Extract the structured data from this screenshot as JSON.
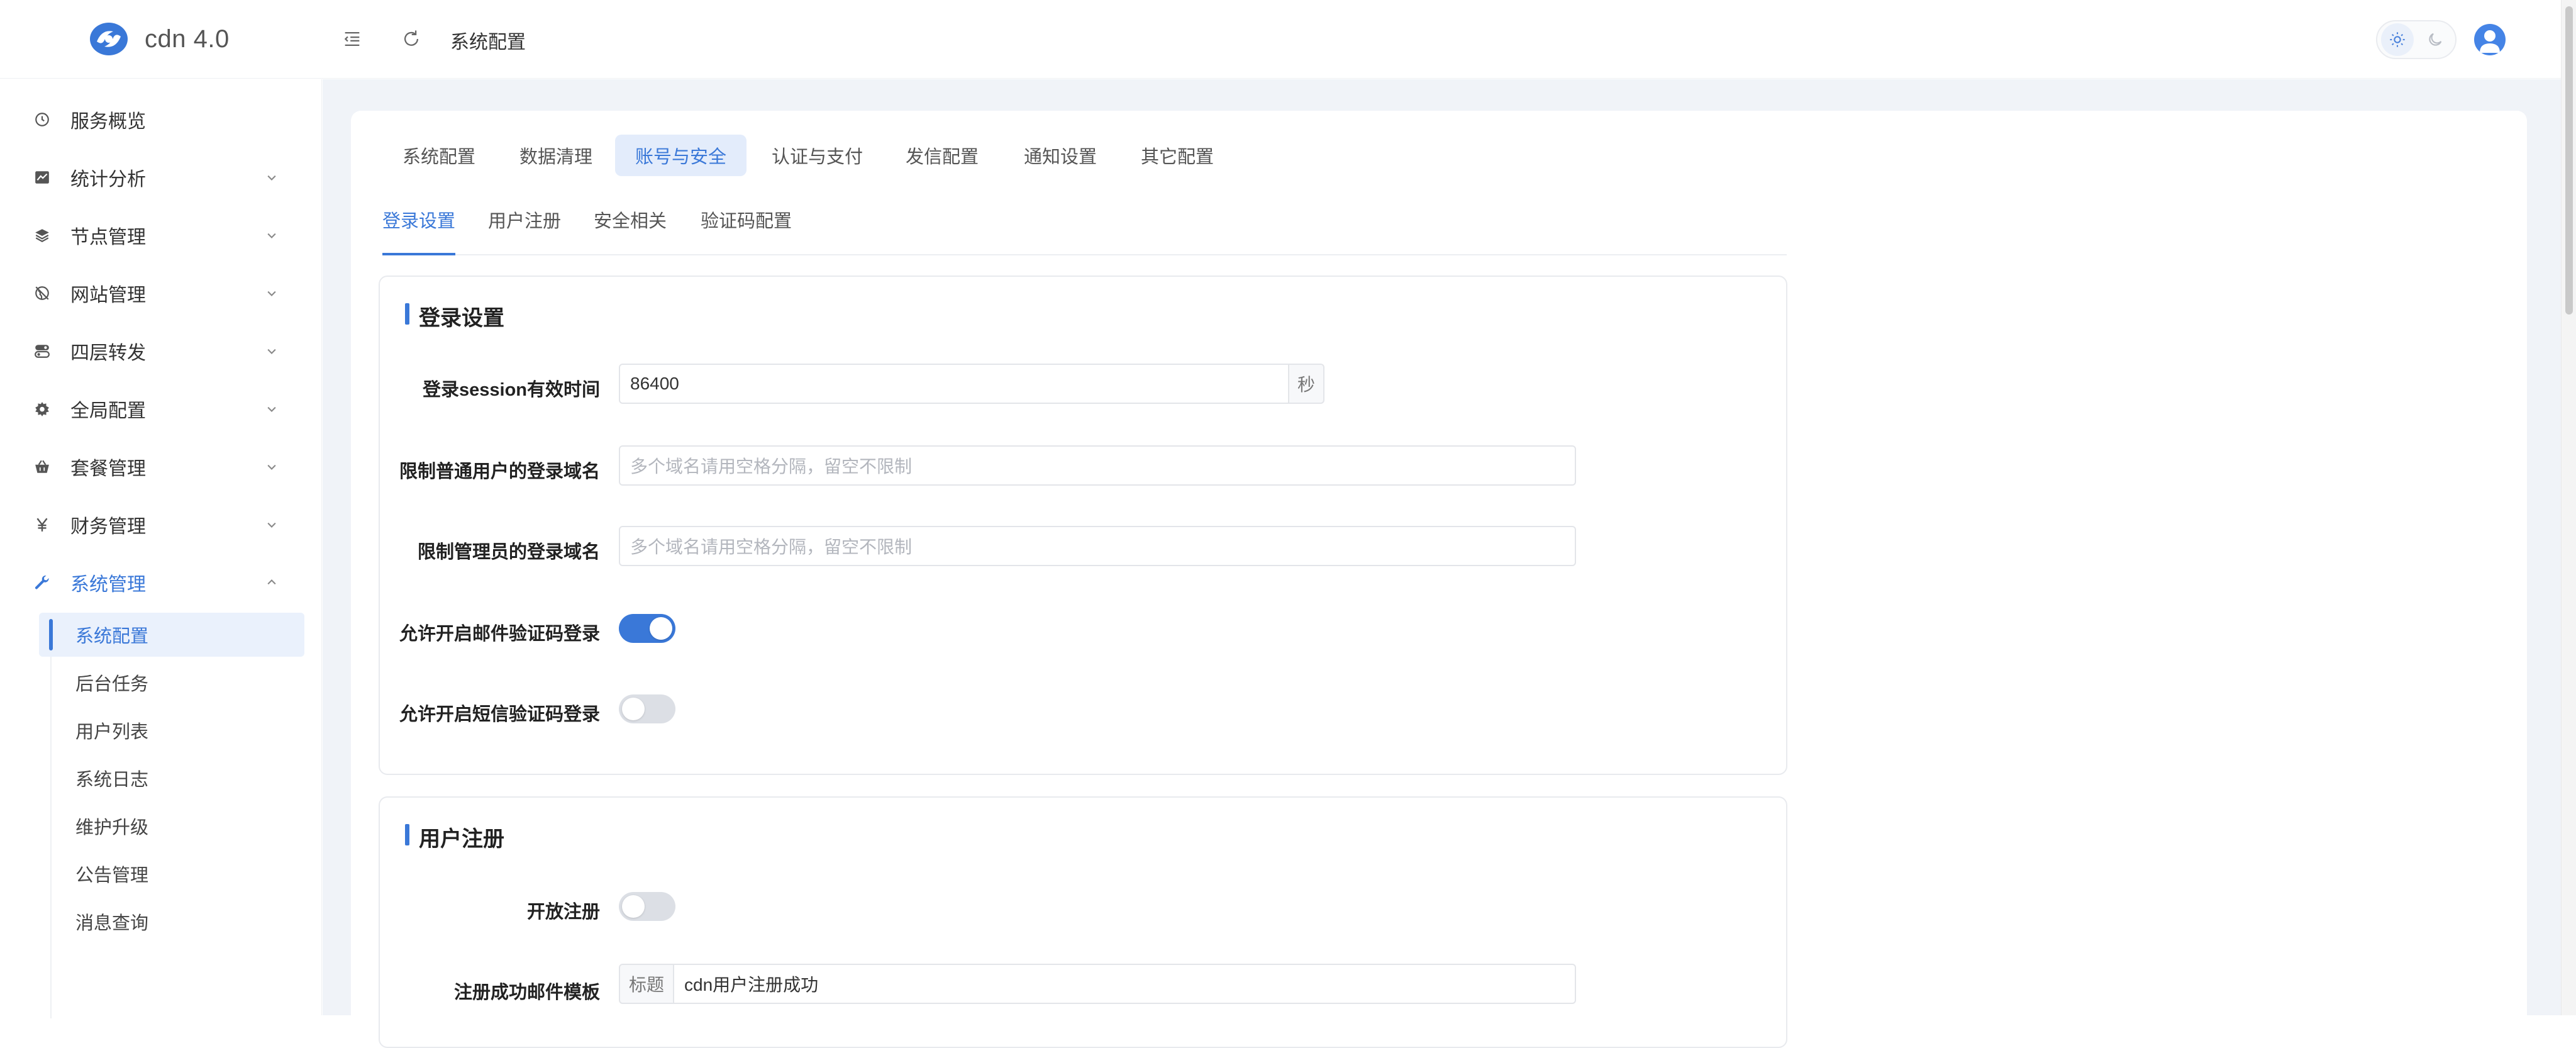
{
  "app": {
    "name": "cdn 4.0"
  },
  "header": {
    "breadcrumb": "系统配置",
    "collapse_icon": "menu-fold-icon",
    "refresh_icon": "refresh-icon",
    "theme_light_icon": "sun-icon",
    "theme_dark_icon": "moon-icon",
    "avatar_icon": "user-icon"
  },
  "colors": {
    "accent": "#3a78d8",
    "accent_light": "#e3ecfb",
    "main_bg": "#f0f3f8"
  },
  "sidebar": {
    "items": [
      {
        "label": "服务概览",
        "icon": "dashboard-icon"
      },
      {
        "label": "统计分析",
        "icon": "chart-icon"
      },
      {
        "label": "节点管理",
        "icon": "layers-icon"
      },
      {
        "label": "网站管理",
        "icon": "globe-icon"
      },
      {
        "label": "四层转发",
        "icon": "forward-icon"
      },
      {
        "label": "全局配置",
        "icon": "gear-icon"
      },
      {
        "label": "套餐管理",
        "icon": "basket-icon"
      },
      {
        "label": "财务管理",
        "icon": "yen-icon"
      },
      {
        "label": "系统管理",
        "icon": "wrench-icon"
      }
    ],
    "sub_items": [
      {
        "label": "系统配置"
      },
      {
        "label": "后台任务"
      },
      {
        "label": "用户列表"
      },
      {
        "label": "系统日志"
      },
      {
        "label": "维护升级"
      },
      {
        "label": "公告管理"
      },
      {
        "label": "消息查询"
      }
    ]
  },
  "tabs": [
    {
      "label": "系统配置"
    },
    {
      "label": "数据清理"
    },
    {
      "label": "账号与安全"
    },
    {
      "label": "认证与支付"
    },
    {
      "label": "发信配置"
    },
    {
      "label": "通知设置"
    },
    {
      "label": "其它配置"
    }
  ],
  "active_tab": "账号与安全",
  "subtabs": [
    {
      "label": "登录设置"
    },
    {
      "label": "用户注册"
    },
    {
      "label": "安全相关"
    },
    {
      "label": "验证码配置"
    }
  ],
  "login_section": {
    "title": "登录设置",
    "session_label": "登录session有效时间",
    "session_value": "86400",
    "session_unit": "秒",
    "user_domain_label": "限制普通用户的登录域名",
    "user_domain_placeholder": "多个域名请用空格分隔，留空不限制",
    "admin_domain_label": "限制管理员的登录域名",
    "admin_domain_placeholder": "多个域名请用空格分隔，留空不限制",
    "email_code_label": "允许开启邮件验证码登录",
    "email_code_enabled": true,
    "sms_code_label": "允许开启短信验证码登录",
    "sms_code_enabled": false
  },
  "register_section": {
    "title": "用户注册",
    "open_register_label": "开放注册",
    "open_register_enabled": false,
    "success_mail_label": "注册成功邮件模板",
    "success_mail_addon": "标题",
    "success_mail_value": "cdn用户注册成功"
  }
}
